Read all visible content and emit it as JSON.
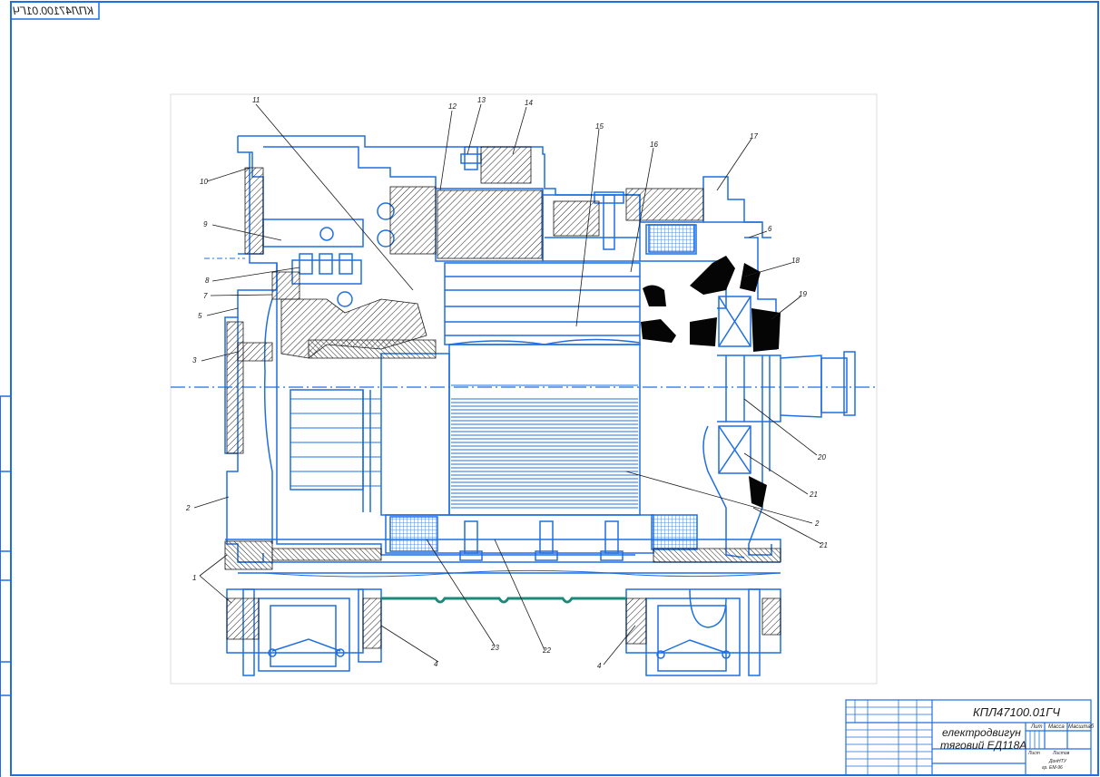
{
  "drawing": {
    "code": "КПЛ47100.01ГЧ",
    "code_mirrored": "КПЛ47100.01ГЧ",
    "title_line1": "електродвигун",
    "title_line2": "тяговий ЕД118А",
    "callouts": [
      "1",
      "2",
      "2",
      "3",
      "4",
      "4",
      "5",
      "6",
      "7",
      "8",
      "9",
      "10",
      "11",
      "12",
      "13",
      "14",
      "15",
      "16",
      "17",
      "18",
      "19",
      "20",
      "21",
      "21",
      "22",
      "23"
    ]
  },
  "title_block": {
    "header_lit": "Лит",
    "header_mass": "Масса",
    "header_scale": "Масштаб",
    "sheet_label": "Лист",
    "sheets_label": "Листов",
    "org_line1": "ДонНТУ",
    "org_line2": "гр. ЕМ-96"
  },
  "colors": {
    "outline": "#1f6fe0",
    "hatch": "#1a1a1a",
    "solid": "#050505",
    "chain": "#1a8a7a",
    "frame": "#1f6fe0"
  }
}
